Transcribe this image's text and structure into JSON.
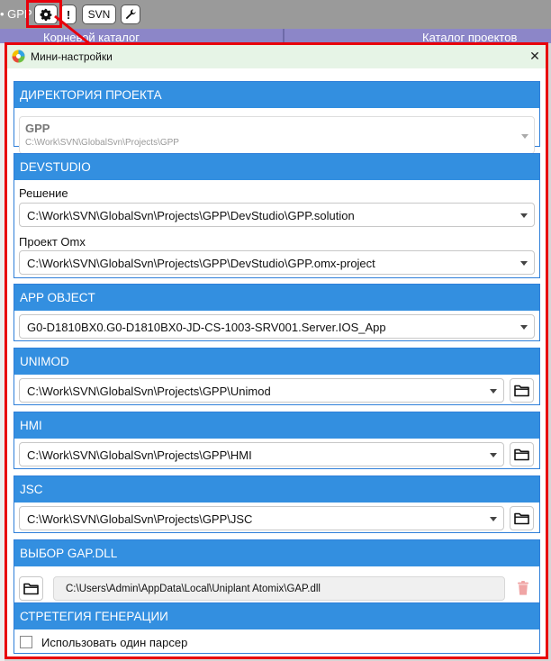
{
  "topbar": {
    "breadcrumb": "• GPP",
    "svn_label": "SVN",
    "info_label": "!"
  },
  "tabs": {
    "left": "Корневой каталог",
    "right": "Каталог проектов"
  },
  "dialog": {
    "title": "Мини-настройки",
    "close_glyph": "✕"
  },
  "sections": {
    "project_dir": {
      "header": "ДИРЕКТОРИЯ ПРОЕКТА",
      "project_name": "GPP",
      "project_path": "C:\\Work\\SVN\\GlobalSvn\\Projects\\GPP"
    },
    "devstudio": {
      "header": "DEVSTUDIO",
      "solution_label": "Решение",
      "solution_value": "C:\\Work\\SVN\\GlobalSvn\\Projects\\GPP\\DevStudio\\GPP.solution",
      "omx_label": "Проект Omx",
      "omx_value": "C:\\Work\\SVN\\GlobalSvn\\Projects\\GPP\\DevStudio\\GPP.omx-project"
    },
    "app_object": {
      "header": "APP OBJECT",
      "value": "G0-D1810BX0.G0-D1810BX0-JD-CS-1003-SRV001.Server.IOS_App"
    },
    "unimod": {
      "header": "UNIMOD",
      "value": "C:\\Work\\SVN\\GlobalSvn\\Projects\\GPP\\Unimod"
    },
    "hmi": {
      "header": "HMI",
      "value": "C:\\Work\\SVN\\GlobalSvn\\Projects\\GPP\\HMI"
    },
    "jsc": {
      "header": "JSC",
      "value": "C:\\Work\\SVN\\GlobalSvn\\Projects\\GPP\\JSC"
    },
    "gap_dll": {
      "header": "ВЫБОР GAP.DLL",
      "value": "C:\\Users\\Admin\\AppData\\Local\\Uniplant Atomix\\GAP.dll"
    },
    "strategy": {
      "header": "СТРЕТЕГИЯ ГЕНЕРАЦИИ",
      "checkbox_label": "Использовать один парсер",
      "checked": false
    }
  },
  "colors": {
    "section_header": "#338fe0",
    "highlight": "#e8000b",
    "titlebar": "#e6f4e6",
    "trash": "#f0a5a5"
  },
  "icons": [
    "gear-icon",
    "wrench-icon",
    "folder-icon",
    "trash-icon",
    "chevron-down-icon",
    "close-icon",
    "app-logo-icon"
  ]
}
